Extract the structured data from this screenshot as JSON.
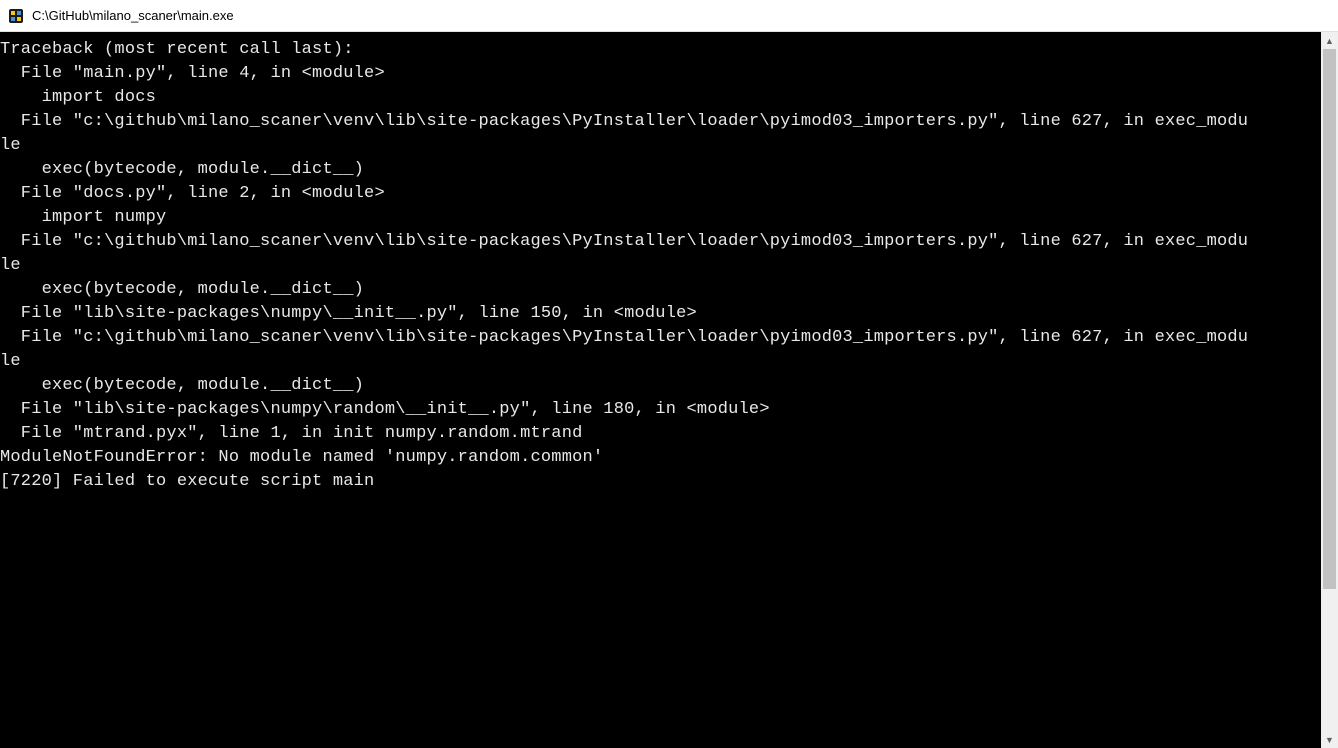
{
  "titlebar": {
    "title": "C:\\GitHub\\milano_scaner\\main.exe"
  },
  "console": {
    "lines": [
      "Traceback (most recent call last):",
      "  File \"main.py\", line 4, in <module>",
      "    import docs",
      "  File \"c:\\github\\milano_scaner\\venv\\lib\\site-packages\\PyInstaller\\loader\\pyimod03_importers.py\", line 627, in exec_modu",
      "le",
      "    exec(bytecode, module.__dict__)",
      "  File \"docs.py\", line 2, in <module>",
      "    import numpy",
      "  File \"c:\\github\\milano_scaner\\venv\\lib\\site-packages\\PyInstaller\\loader\\pyimod03_importers.py\", line 627, in exec_modu",
      "le",
      "    exec(bytecode, module.__dict__)",
      "  File \"lib\\site-packages\\numpy\\__init__.py\", line 150, in <module>",
      "  File \"c:\\github\\milano_scaner\\venv\\lib\\site-packages\\PyInstaller\\loader\\pyimod03_importers.py\", line 627, in exec_modu",
      "le",
      "    exec(bytecode, module.__dict__)",
      "  File \"lib\\site-packages\\numpy\\random\\__init__.py\", line 180, in <module>",
      "  File \"mtrand.pyx\", line 1, in init numpy.random.mtrand",
      "ModuleNotFoundError: No module named 'numpy.random.common'",
      "[7220] Failed to execute script main"
    ]
  }
}
